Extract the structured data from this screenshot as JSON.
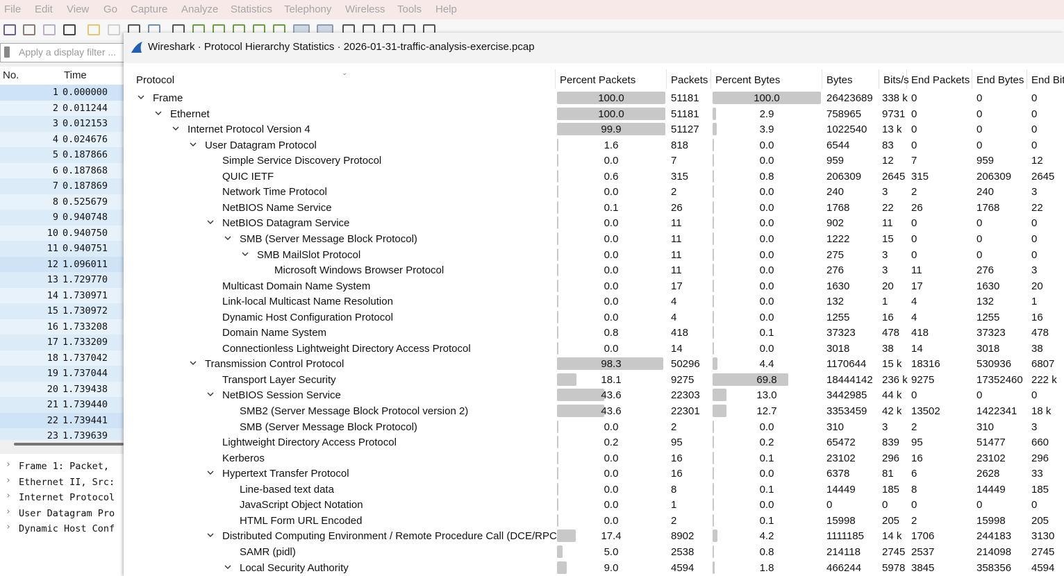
{
  "main": {
    "menu": [
      "File",
      "Edit",
      "View",
      "Go",
      "Capture",
      "Analyze",
      "Statistics",
      "Telephony",
      "Wireless",
      "Tools",
      "Help"
    ],
    "filter_placeholder": "Apply a display filter ...",
    "columns": {
      "no": "No.",
      "time": "Time"
    },
    "packets": [
      {
        "no": "1",
        "time": "0.000000"
      },
      {
        "no": "2",
        "time": "0.011244"
      },
      {
        "no": "3",
        "time": "0.012153"
      },
      {
        "no": "4",
        "time": "0.024676"
      },
      {
        "no": "5",
        "time": "0.187866"
      },
      {
        "no": "6",
        "time": "0.187868"
      },
      {
        "no": "7",
        "time": "0.187869"
      },
      {
        "no": "8",
        "time": "0.525679"
      },
      {
        "no": "9",
        "time": "0.940748"
      },
      {
        "no": "10",
        "time": "0.940750"
      },
      {
        "no": "11",
        "time": "0.940751"
      },
      {
        "no": "12",
        "time": "1.096011"
      },
      {
        "no": "13",
        "time": "1.729770"
      },
      {
        "no": "14",
        "time": "1.730971"
      },
      {
        "no": "15",
        "time": "1.730972"
      },
      {
        "no": "16",
        "time": "1.733208"
      },
      {
        "no": "17",
        "time": "1.733209"
      },
      {
        "no": "18",
        "time": "1.737042"
      },
      {
        "no": "19",
        "time": "1.737044"
      },
      {
        "no": "20",
        "time": "1.739438"
      },
      {
        "no": "21",
        "time": "1.739440"
      },
      {
        "no": "22",
        "time": "1.739441"
      },
      {
        "no": "23",
        "time": "1.739639"
      }
    ],
    "details": [
      "Frame 1: Packet,",
      "Ethernet II, Src:",
      "Internet Protocol",
      "User Datagram Pro",
      "Dynamic Host Conf"
    ]
  },
  "dialog": {
    "title": "Wireshark · Protocol Hierarchy Statistics · 2026-01-31-traffic-analysis-exercise.pcap",
    "headers": [
      "Protocol",
      "Percent Packets",
      "Packets",
      "Percent Bytes",
      "Bytes",
      "Bits/s",
      "End Packets",
      "End Bytes",
      "End Bit"
    ],
    "rows": [
      {
        "depth": 0,
        "exp": true,
        "name": "Frame",
        "pp": "100.0",
        "ppv": 100.0,
        "pk": "51181",
        "pb": "100.0",
        "pbv": 100.0,
        "by": "26423689",
        "bps": "338 k",
        "ep": "0",
        "eb": "0",
        "ebs": "0"
      },
      {
        "depth": 1,
        "exp": true,
        "name": "Ethernet",
        "pp": "100.0",
        "ppv": 100.0,
        "pk": "51181",
        "pb": "2.9",
        "pbv": 2.9,
        "by": "758965",
        "bps": "9731",
        "ep": "0",
        "eb": "0",
        "ebs": "0"
      },
      {
        "depth": 2,
        "exp": true,
        "name": "Internet Protocol Version 4",
        "pp": "99.9",
        "ppv": 99.9,
        "pk": "51127",
        "pb": "3.9",
        "pbv": 3.9,
        "by": "1022540",
        "bps": "13 k",
        "ep": "0",
        "eb": "0",
        "ebs": "0"
      },
      {
        "depth": 3,
        "exp": true,
        "name": "User Datagram Protocol",
        "pp": "1.6",
        "ppv": 1.6,
        "pk": "818",
        "pb": "0.0",
        "pbv": 0,
        "by": "6544",
        "bps": "83",
        "ep": "0",
        "eb": "0",
        "ebs": "0"
      },
      {
        "depth": 4,
        "exp": false,
        "name": "Simple Service Discovery Protocol",
        "pp": "0.0",
        "ppv": 0,
        "pk": "7",
        "pb": "0.0",
        "pbv": 0,
        "by": "959",
        "bps": "12",
        "ep": "7",
        "eb": "959",
        "ebs": "12"
      },
      {
        "depth": 4,
        "exp": false,
        "name": "QUIC IETF",
        "pp": "0.6",
        "ppv": 0.6,
        "pk": "315",
        "pb": "0.8",
        "pbv": 0.8,
        "by": "206309",
        "bps": "2645",
        "ep": "315",
        "eb": "206309",
        "ebs": "2645"
      },
      {
        "depth": 4,
        "exp": false,
        "name": "Network Time Protocol",
        "pp": "0.0",
        "ppv": 0,
        "pk": "2",
        "pb": "0.0",
        "pbv": 0,
        "by": "240",
        "bps": "3",
        "ep": "2",
        "eb": "240",
        "ebs": "3"
      },
      {
        "depth": 4,
        "exp": false,
        "name": "NetBIOS Name Service",
        "pp": "0.1",
        "ppv": 0.1,
        "pk": "26",
        "pb": "0.0",
        "pbv": 0,
        "by": "1768",
        "bps": "22",
        "ep": "26",
        "eb": "1768",
        "ebs": "22"
      },
      {
        "depth": 4,
        "exp": true,
        "name": "NetBIOS Datagram Service",
        "pp": "0.0",
        "ppv": 0,
        "pk": "11",
        "pb": "0.0",
        "pbv": 0,
        "by": "902",
        "bps": "11",
        "ep": "0",
        "eb": "0",
        "ebs": "0"
      },
      {
        "depth": 5,
        "exp": true,
        "name": "SMB (Server Message Block Protocol)",
        "pp": "0.0",
        "ppv": 0,
        "pk": "11",
        "pb": "0.0",
        "pbv": 0,
        "by": "1222",
        "bps": "15",
        "ep": "0",
        "eb": "0",
        "ebs": "0"
      },
      {
        "depth": 6,
        "exp": true,
        "name": "SMB MailSlot Protocol",
        "pp": "0.0",
        "ppv": 0,
        "pk": "11",
        "pb": "0.0",
        "pbv": 0,
        "by": "275",
        "bps": "3",
        "ep": "0",
        "eb": "0",
        "ebs": "0"
      },
      {
        "depth": 7,
        "exp": false,
        "name": "Microsoft Windows Browser Protocol",
        "pp": "0.0",
        "ppv": 0,
        "pk": "11",
        "pb": "0.0",
        "pbv": 0,
        "by": "276",
        "bps": "3",
        "ep": "11",
        "eb": "276",
        "ebs": "3"
      },
      {
        "depth": 4,
        "exp": false,
        "name": "Multicast Domain Name System",
        "pp": "0.0",
        "ppv": 0,
        "pk": "17",
        "pb": "0.0",
        "pbv": 0,
        "by": "1630",
        "bps": "20",
        "ep": "17",
        "eb": "1630",
        "ebs": "20"
      },
      {
        "depth": 4,
        "exp": false,
        "name": "Link-local Multicast Name Resolution",
        "pp": "0.0",
        "ppv": 0,
        "pk": "4",
        "pb": "0.0",
        "pbv": 0,
        "by": "132",
        "bps": "1",
        "ep": "4",
        "eb": "132",
        "ebs": "1"
      },
      {
        "depth": 4,
        "exp": false,
        "name": "Dynamic Host Configuration Protocol",
        "pp": "0.0",
        "ppv": 0,
        "pk": "4",
        "pb": "0.0",
        "pbv": 0,
        "by": "1255",
        "bps": "16",
        "ep": "4",
        "eb": "1255",
        "ebs": "16"
      },
      {
        "depth": 4,
        "exp": false,
        "name": "Domain Name System",
        "pp": "0.8",
        "ppv": 0.8,
        "pk": "418",
        "pb": "0.1",
        "pbv": 0.1,
        "by": "37323",
        "bps": "478",
        "ep": "418",
        "eb": "37323",
        "ebs": "478"
      },
      {
        "depth": 4,
        "exp": false,
        "name": "Connectionless Lightweight Directory Access Protocol",
        "pp": "0.0",
        "ppv": 0,
        "pk": "14",
        "pb": "0.0",
        "pbv": 0,
        "by": "3018",
        "bps": "38",
        "ep": "14",
        "eb": "3018",
        "ebs": "38"
      },
      {
        "depth": 3,
        "exp": true,
        "name": "Transmission Control Protocol",
        "pp": "98.3",
        "ppv": 98.3,
        "pk": "50296",
        "pb": "4.4",
        "pbv": 4.4,
        "by": "1170644",
        "bps": "15 k",
        "ep": "18316",
        "eb": "530936",
        "ebs": "6807"
      },
      {
        "depth": 4,
        "exp": false,
        "name": "Transport Layer Security",
        "pp": "18.1",
        "ppv": 18.1,
        "pk": "9275",
        "pb": "69.8",
        "pbv": 69.8,
        "by": "18444142",
        "bps": "236 k",
        "ep": "9275",
        "eb": "17352460",
        "ebs": "222 k"
      },
      {
        "depth": 4,
        "exp": true,
        "name": "NetBIOS Session Service",
        "pp": "43.6",
        "ppv": 43.6,
        "pk": "22303",
        "pb": "13.0",
        "pbv": 13.0,
        "by": "3442985",
        "bps": "44 k",
        "ep": "0",
        "eb": "0",
        "ebs": "0"
      },
      {
        "depth": 5,
        "exp": false,
        "name": "SMB2 (Server Message Block Protocol version 2)",
        "pp": "43.6",
        "ppv": 43.6,
        "pk": "22301",
        "pb": "12.7",
        "pbv": 12.7,
        "by": "3353459",
        "bps": "42 k",
        "ep": "13502",
        "eb": "1422341",
        "ebs": "18 k"
      },
      {
        "depth": 5,
        "exp": false,
        "name": "SMB (Server Message Block Protocol)",
        "pp": "0.0",
        "ppv": 0,
        "pk": "2",
        "pb": "0.0",
        "pbv": 0,
        "by": "310",
        "bps": "3",
        "ep": "2",
        "eb": "310",
        "ebs": "3"
      },
      {
        "depth": 4,
        "exp": false,
        "name": "Lightweight Directory Access Protocol",
        "pp": "0.2",
        "ppv": 0.2,
        "pk": "95",
        "pb": "0.2",
        "pbv": 0.2,
        "by": "65472",
        "bps": "839",
        "ep": "95",
        "eb": "51477",
        "ebs": "660"
      },
      {
        "depth": 4,
        "exp": false,
        "name": "Kerberos",
        "pp": "0.0",
        "ppv": 0,
        "pk": "16",
        "pb": "0.1",
        "pbv": 0.1,
        "by": "23102",
        "bps": "296",
        "ep": "16",
        "eb": "23102",
        "ebs": "296"
      },
      {
        "depth": 4,
        "exp": true,
        "name": "Hypertext Transfer Protocol",
        "pp": "0.0",
        "ppv": 0,
        "pk": "16",
        "pb": "0.0",
        "pbv": 0,
        "by": "6378",
        "bps": "81",
        "ep": "6",
        "eb": "2628",
        "ebs": "33"
      },
      {
        "depth": 5,
        "exp": false,
        "name": "Line-based text data",
        "pp": "0.0",
        "ppv": 0,
        "pk": "8",
        "pb": "0.1",
        "pbv": 0.1,
        "by": "14449",
        "bps": "185",
        "ep": "8",
        "eb": "14449",
        "ebs": "185"
      },
      {
        "depth": 5,
        "exp": false,
        "name": "JavaScript Object Notation",
        "pp": "0.0",
        "ppv": 0,
        "pk": "1",
        "pb": "0.0",
        "pbv": 0,
        "by": "0",
        "bps": "0",
        "ep": "0",
        "eb": "0",
        "ebs": "0"
      },
      {
        "depth": 5,
        "exp": false,
        "name": "HTML Form URL Encoded",
        "pp": "0.0",
        "ppv": 0,
        "pk": "2",
        "pb": "0.1",
        "pbv": 0.1,
        "by": "15998",
        "bps": "205",
        "ep": "2",
        "eb": "15998",
        "ebs": "205"
      },
      {
        "depth": 4,
        "exp": true,
        "name": "Distributed Computing Environment / Remote Procedure Call (DCE/RPC)",
        "pp": "17.4",
        "ppv": 17.4,
        "pk": "8902",
        "pb": "4.2",
        "pbv": 4.2,
        "by": "1111185",
        "bps": "14 k",
        "ep": "1706",
        "eb": "244183",
        "ebs": "3130"
      },
      {
        "depth": 5,
        "exp": false,
        "name": "SAMR (pidl)",
        "pp": "5.0",
        "ppv": 5.0,
        "pk": "2538",
        "pb": "0.8",
        "pbv": 0.8,
        "by": "214118",
        "bps": "2745",
        "ep": "2537",
        "eb": "214098",
        "ebs": "2745"
      },
      {
        "depth": 5,
        "exp": true,
        "name": "Local Security Authority",
        "pp": "9.0",
        "ppv": 9.0,
        "pk": "4594",
        "pb": "1.8",
        "pbv": 1.8,
        "by": "466244",
        "bps": "5978",
        "ep": "3845",
        "eb": "358356",
        "ebs": "4594"
      }
    ]
  }
}
